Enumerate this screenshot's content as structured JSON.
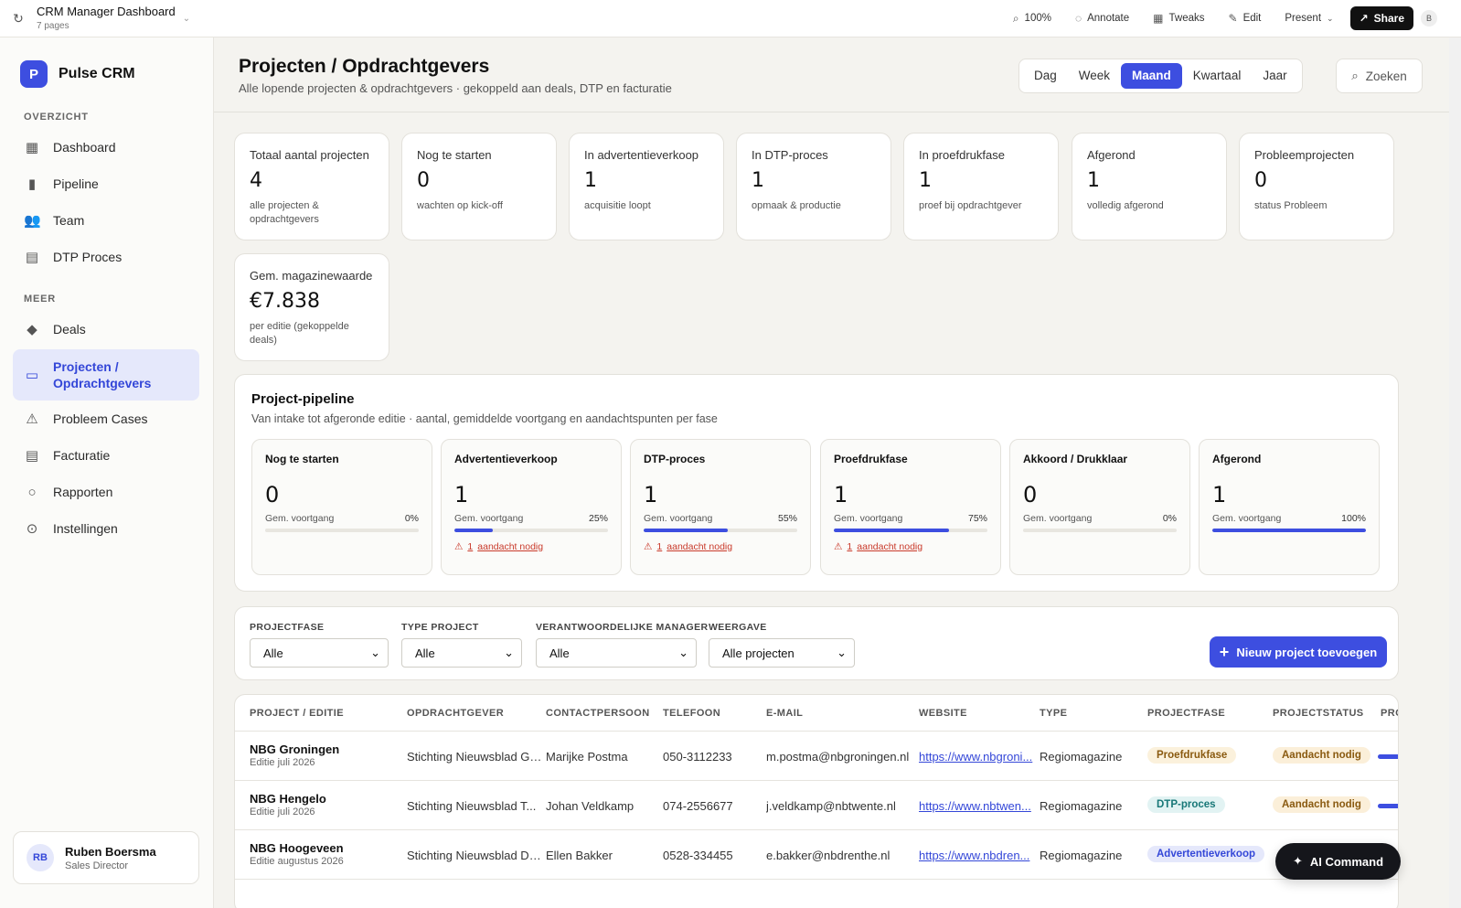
{
  "topbar": {
    "title": "CRM Manager Dashboard",
    "pages": "7 pages",
    "zoom": "100%",
    "annotate": "Annotate",
    "tweaks": "Tweaks",
    "edit": "Edit",
    "present": "Present",
    "share": "Share",
    "user_initial": "B"
  },
  "brand": {
    "logo": "P",
    "name": "Pulse CRM"
  },
  "sidebar": {
    "section1": "OVERZICHT",
    "section2": "MEER",
    "items": [
      {
        "label": "Dashboard",
        "icon": "grid-icon"
      },
      {
        "label": "Pipeline",
        "icon": "bar-chart-icon"
      },
      {
        "label": "Team",
        "icon": "users-icon"
      },
      {
        "label": "DTP Proces",
        "icon": "document-icon"
      },
      {
        "label": "Deals",
        "icon": "diamond-icon"
      },
      {
        "label": "Projecten / Opdrachtgevers",
        "icon": "folder-icon",
        "active": true
      },
      {
        "label": "Probleem Cases",
        "icon": "warning-icon"
      },
      {
        "label": "Facturatie",
        "icon": "invoice-icon"
      },
      {
        "label": "Rapporten",
        "icon": "circle-icon"
      },
      {
        "label": "Instellingen",
        "icon": "settings-icon"
      }
    ],
    "user": {
      "initials": "RB",
      "name": "Ruben Boersma",
      "role": "Sales Director"
    }
  },
  "header": {
    "title": "Projecten / Opdrachtgevers",
    "subtitle": "Alle lopende projecten & opdrachtgevers · gekoppeld aan deals, DTP en facturatie",
    "periods": [
      "Dag",
      "Week",
      "Maand",
      "Kwartaal",
      "Jaar"
    ],
    "active_period": "Maand",
    "search": "Zoeken"
  },
  "kpis": [
    {
      "label": "Totaal aantal projecten",
      "value": "4",
      "sub": "alle projecten & opdrachtgevers"
    },
    {
      "label": "Nog te starten",
      "value": "0",
      "sub": "wachten op kick-off"
    },
    {
      "label": "In advertentieverkoop",
      "value": "1",
      "sub": "acquisitie loopt"
    },
    {
      "label": "In DTP-proces",
      "value": "1",
      "sub": "opmaak & productie"
    },
    {
      "label": "In proefdrukfase",
      "value": "1",
      "sub": "proef bij opdrachtgever"
    },
    {
      "label": "Afgerond",
      "value": "1",
      "sub": "volledig afgerond"
    },
    {
      "label": "Probleemprojecten",
      "value": "0",
      "sub": "status Probleem"
    },
    {
      "label": "Gem. magazinewaarde",
      "value": "€7.838",
      "sub": "per editie (gekoppelde deals)"
    }
  ],
  "pipeline": {
    "title": "Project-pipeline",
    "subtitle": "Van intake tot afgeronde editie · aantal, gemiddelde voortgang en aandachtspunten per fase",
    "progress_label": "Gem. voortgang",
    "warn_label": "aandacht nodig",
    "stages": [
      {
        "name": "Nog te starten",
        "count": "0",
        "pct": "0%",
        "progress": 0,
        "warn": ""
      },
      {
        "name": "Advertentieverkoop",
        "count": "1",
        "pct": "25%",
        "progress": 25,
        "warn": "1"
      },
      {
        "name": "DTP-proces",
        "count": "1",
        "pct": "55%",
        "progress": 55,
        "warn": "1"
      },
      {
        "name": "Proefdrukfase",
        "count": "1",
        "pct": "75%",
        "progress": 75,
        "warn": "1"
      },
      {
        "name": "Akkoord / Drukklaar",
        "count": "0",
        "pct": "0%",
        "progress": 0,
        "warn": ""
      },
      {
        "name": "Afgerond",
        "count": "1",
        "pct": "100%",
        "progress": 100,
        "warn": ""
      }
    ]
  },
  "filters": {
    "fase": {
      "label": "PROJECTFASE",
      "value": "Alle"
    },
    "type": {
      "label": "TYPE PROJECT",
      "value": "Alle"
    },
    "manager": {
      "label": "VERANTWOORDELIJKE MANAGER",
      "value": "Alle"
    },
    "weergave": {
      "label": "WEERGAVE",
      "value": "Alle projecten"
    },
    "add_button": "Nieuw project toevoegen"
  },
  "table": {
    "columns": [
      "PROJECT / EDITIE",
      "OPDRACHTGEVER",
      "CONTACTPERSOON",
      "TELEFOON",
      "E-MAIL",
      "WEBSITE",
      "TYPE",
      "PROJECTFASE",
      "PROJECTSTATUS",
      "PRO"
    ],
    "rows": [
      {
        "project": "NBG Groningen",
        "editie": "Editie juli 2026",
        "opdrachtgever": "Stichting Nieuwsblad Gr...",
        "contact": "Marijke Postma",
        "telefoon": "050-3112233",
        "email": "m.postma@nbgroningen.nl",
        "website": "https://www.nbgroni...",
        "type": "Regiomagazine",
        "fase": "Proefdrukfase",
        "status": "Aandacht nodig"
      },
      {
        "project": "NBG Hengelo",
        "editie": "Editie juli 2026",
        "opdrachtgever": "Stichting Nieuwsblad T...",
        "contact": "Johan Veldkamp",
        "telefoon": "074-2556677",
        "email": "j.veldkamp@nbtwente.nl",
        "website": "https://www.nbtwen...",
        "type": "Regiomagazine",
        "fase": "DTP-proces",
        "status": "Aandacht nodig"
      },
      {
        "project": "NBG Hoogeveen",
        "editie": "Editie augustus 2026",
        "opdrachtgever": "Stichting Nieuwsblad Dr...",
        "contact": "Ellen Bakker",
        "telefoon": "0528-334455",
        "email": "e.bakker@nbdrenthe.nl",
        "website": "https://www.nbdren...",
        "type": "Regiomagazine",
        "fase": "Advertentieverkoop",
        "status": ""
      }
    ]
  },
  "ai_command": "AI Command",
  "colors": {
    "accent": "#3d4ee0",
    "warning": "#c93a2b",
    "background": "#f4f3ef"
  }
}
